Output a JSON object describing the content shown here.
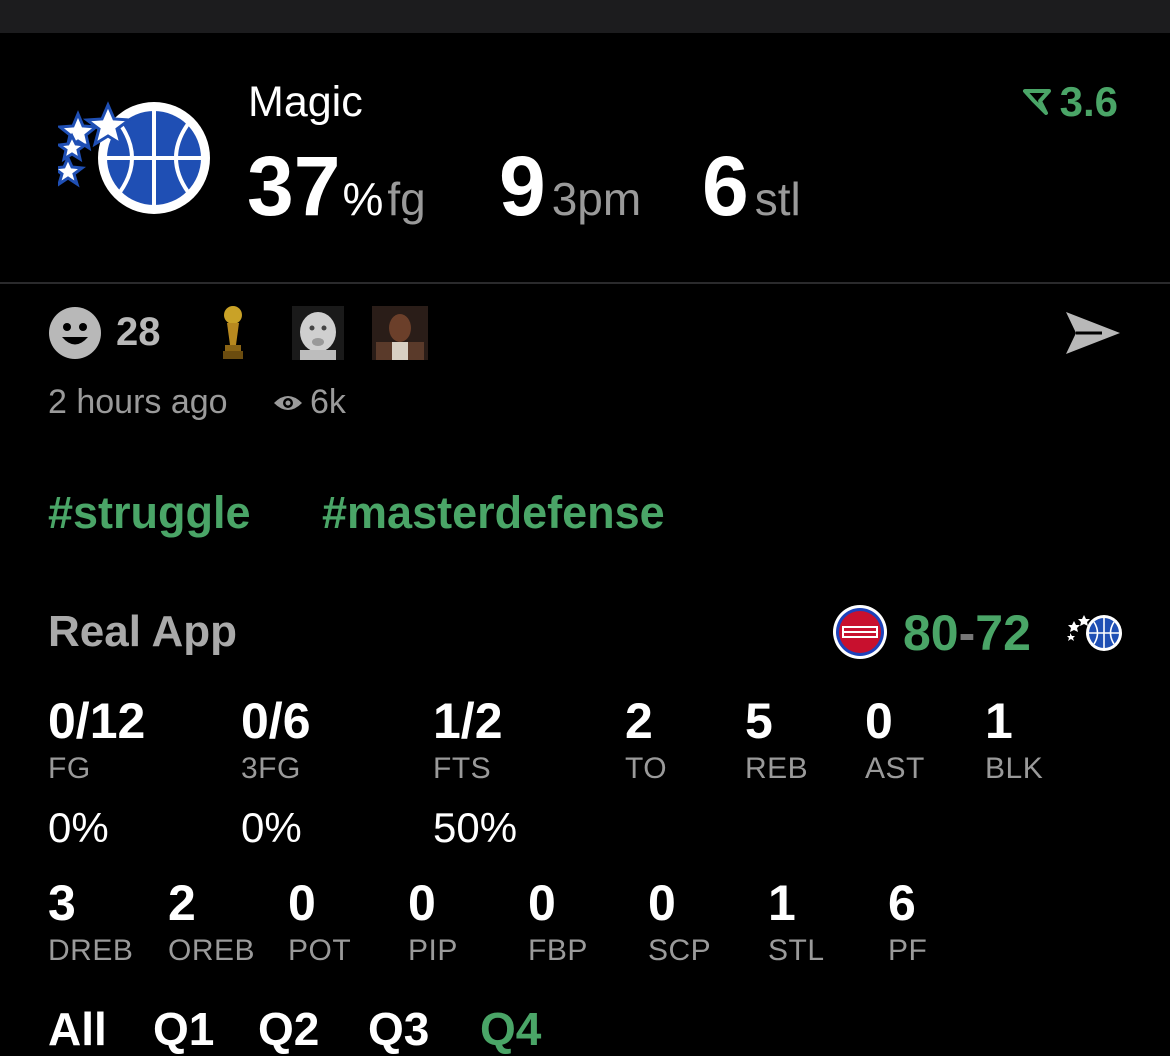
{
  "header": {
    "team_name": "Magic",
    "fg_value": "37",
    "fg_pct_symbol": "%",
    "fg_unit": "fg",
    "threes_value": "9",
    "threes_unit": "3pm",
    "steals_value": "6",
    "steals_unit": "stl",
    "rating": "3.6"
  },
  "reactions": {
    "count": "28",
    "time_ago": "2 hours ago",
    "views": "6k"
  },
  "hashtags": [
    "#struggle",
    "#masterdefense"
  ],
  "game": {
    "app_label": "Real App",
    "home_score": "80",
    "separator": "-",
    "away_score": "72"
  },
  "stats_row1": [
    {
      "value": "0/12",
      "label": "FG",
      "pct": "0%"
    },
    {
      "value": "0/6",
      "label": "3FG",
      "pct": "0%"
    },
    {
      "value": "1/2",
      "label": "FTS",
      "pct": "50%"
    },
    {
      "value": "2",
      "label": "TO"
    },
    {
      "value": "5",
      "label": "REB"
    },
    {
      "value": "0",
      "label": "AST"
    },
    {
      "value": "1",
      "label": "BLK"
    }
  ],
  "stats_row2": [
    {
      "value": "3",
      "label": "DREB"
    },
    {
      "value": "2",
      "label": "OREB"
    },
    {
      "value": "0",
      "label": "POT"
    },
    {
      "value": "0",
      "label": "PIP"
    },
    {
      "value": "0",
      "label": "FBP"
    },
    {
      "value": "0",
      "label": "SCP"
    },
    {
      "value": "1",
      "label": "STL"
    },
    {
      "value": "6",
      "label": "PF"
    }
  ],
  "quarters": [
    "All",
    "Q1",
    "Q2",
    "Q3",
    "Q4"
  ],
  "colors": {
    "accent_green": "#4aa567",
    "magic_blue": "#1f4fb4",
    "pistons_red": "#c8102e"
  },
  "icons": {
    "rating": "funnel-arrow-icon",
    "reaction": "smiley-icon",
    "trophy": "trophy-icon",
    "share": "send-icon",
    "views": "eye-icon"
  }
}
